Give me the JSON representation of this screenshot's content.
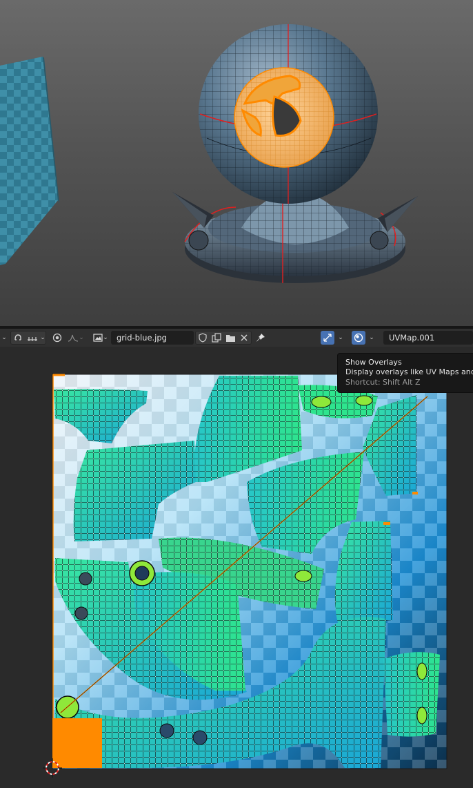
{
  "uv_header": {
    "image_name": "grid-blue.jpg",
    "uv_map_name": "UVMap.001"
  },
  "tooltip": {
    "title": "Show Overlays",
    "description": "Display overlays like UV Maps and Metadata",
    "shortcut": "Shortcut: Shift Alt Z"
  },
  "colors": {
    "viewport_top": "#6a6a6a",
    "viewport_bottom": "#3e3e3e",
    "header_bg": "#303030",
    "editor_bg": "#2a2a2a",
    "selection_orange": "#ff8a00",
    "seam_red": "#e02020",
    "uv_island_green": "#2ee89a",
    "uv_island_teal": "#2ab8d8",
    "checker_blue": "#1c8fd6",
    "active_button_blue": "#4772b3"
  },
  "icons": [
    "sync-selection-icon",
    "uv-select-mode-icon",
    "snap-icon",
    "snap-target-icon",
    "proportional-edit-icon",
    "falloff-icon",
    "image-browse-icon",
    "fake-user-shield-icon",
    "new-image-icon",
    "open-image-icon",
    "unlink-close-icon",
    "pin-icon",
    "show-gizmo-icon",
    "overlays-icon",
    "dropdown-chevron-icon",
    "cursor-2d-icon"
  ]
}
